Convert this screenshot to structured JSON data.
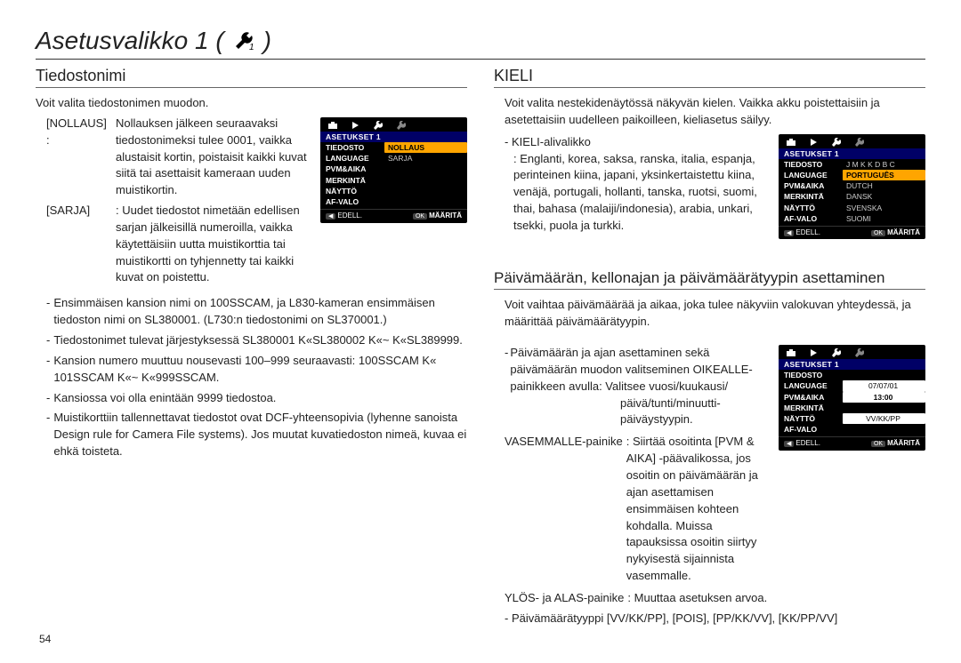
{
  "page": {
    "title": "Asetusvalikko 1 (",
    "title_suffix": ")",
    "number": "54"
  },
  "left": {
    "section_title": "Tiedostonimi",
    "intro": "Voit valita tiedostonimen muodon.",
    "rows": [
      {
        "label": "[NOLLAUS]  :",
        "desc": "Nollauksen jälkeen seuraavaksi tiedostonimeksi tulee 0001, vaikka alustaisit kortin, poistaisit kaikki kuvat siitä tai asettaisit kameraan uuden muistikortin."
      },
      {
        "label": "[SARJA]",
        "desc": ": Uudet tiedostot nimetään edellisen sarjan jälkeisillä numeroilla, vaikka käytettäisiin uutta muistikorttia tai muistikortti on tyhjennetty tai kaikki kuvat on poistettu."
      }
    ],
    "bullets": [
      "Ensimmäisen kansion nimi on 100SSCAM, ja L830-kameran ensimmäisen tiedoston nimi on SL380001. (L730:n tiedostonimi on SL370001.)",
      "Tiedostonimet tulevat järjestyksessä  SL380001 K«SL380002 K«~ K«SL389999.",
      "Kansion numero muuttuu nousevasti 100–999 seuraavasti: 100SSCAM K« 101SSCAM K«~ K«999SSCAM.",
      "Kansiossa voi olla enintään 9999 tiedostoa.",
      "Muistikorttiin tallennettavat tiedostot ovat DCF-yhteensopivia (lyhenne sanoista Design rule for Camera File systems). Jos muutat kuvatiedoston nimeä, kuvaa ei ehkä toisteta."
    ],
    "screen": {
      "header": "ASETUKSET 1",
      "items": [
        {
          "l": "TIEDOSTO",
          "r": "NOLLAUS",
          "sel": true
        },
        {
          "l": "LANGUAGE",
          "r": "SARJA"
        },
        {
          "l": "PVM&AIKA",
          "r": ""
        },
        {
          "l": "MERKINTÄ",
          "r": ""
        },
        {
          "l": "NÄYTTÖ",
          "r": ""
        },
        {
          "l": "AF-VALO",
          "r": ""
        }
      ],
      "footer_left": "EDELL.",
      "footer_right_pill": "OK",
      "footer_right": "MÄÄRITÄ"
    }
  },
  "right1": {
    "section_title": "KIELI",
    "intro": "Voit valita nestekidenäytössä näkyvän kielen. Vaikka akku poistettaisiin ja asetettaisiin uudelleen paikoilleen, kieliasetus säilyy.",
    "sub_label": "- KIELI-alivalikko",
    "sub_desc": ": Englanti, korea, saksa, ranska, italia, espanja, perinteinen kiina, japani, yksinkertaistettu kiina, venäjä, portugali, hollanti, tanska, ruotsi, suomi, thai, bahasa (malaiji/indonesia), arabia, unkari, tsekki, puola ja turkki.",
    "screen": {
      "header": "ASETUKSET 1",
      "items": [
        {
          "l": "TIEDOSTO",
          "r": "J M K K D B C"
        },
        {
          "l": "LANGUAGE",
          "r": "PORTUGUÊS",
          "sel": true
        },
        {
          "l": "PVM&AIKA",
          "r": "DUTCH"
        },
        {
          "l": "MERKINTÄ",
          "r": "DANSK"
        },
        {
          "l": "NÄYTTÖ",
          "r": "SVENSKA"
        },
        {
          "l": "AF-VALO",
          "r": "SUOMI"
        }
      ],
      "footer_left": "EDELL.",
      "footer_right_pill": "OK",
      "footer_right": "MÄÄRITÄ"
    }
  },
  "right2": {
    "section_title": "Päivämäärän, kellonajan ja päivämäärätyypin asettaminen",
    "intro": "Voit vaihtaa päivämäärää ja aikaa, joka tulee näkyviin valokuvan yhteydessä, ja määrittää päivämäärätyypin.",
    "para1_label": "- ",
    "para1": "Päivämäärän ja ajan asettaminen sekä päivämäärän muodon valitseminen OIKEALLE-painikkeen avulla: Valitsee vuosi/kuukausi/",
    "para1_cont1": "päivä/tunti/minuutti-",
    "para1_cont2": "päiväystyypin.",
    "kv": [
      {
        "l": "VASEMMALLE-painike",
        "r": ": Siirtää osoitinta [PVM & AIKA] -päävalikossa, jos osoitin on päivämäärän ja ajan asettamisen ensimmäisen kohteen kohdalla. Muissa tapauksissa osoitin siirtyy nykyisestä sijainnista vasemmalle."
      },
      {
        "l": "YLÖS- ja ALAS-painike",
        "r": ": Muuttaa asetuksen arvoa."
      }
    ],
    "final": "- Päivämäärätyyppi [VV/KK/PP], [POIS], [PP/KK/VV], [KK/PP/VV]",
    "screen": {
      "header": "ASETUKSET 1",
      "items": [
        {
          "l": "TIEDOSTO",
          "r": ""
        },
        {
          "l": "LANGUAGE",
          "r": "07/07/01"
        },
        {
          "l": "PVM&AIKA",
          "r": "13:00",
          "sel": true
        },
        {
          "l": "MERKINTÄ",
          "r": ""
        },
        {
          "l": "NÄYTTÖ",
          "r": "VV/KK/PP"
        },
        {
          "l": "AF-VALO",
          "r": ""
        }
      ],
      "footer_left": "EDELL.",
      "footer_right_pill": "OK",
      "footer_right": "MÄÄRITÄ"
    }
  }
}
